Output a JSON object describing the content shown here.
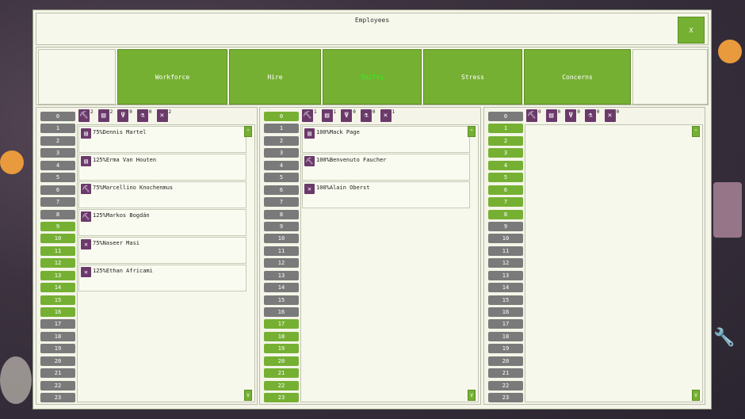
{
  "window": {
    "title": "Employees",
    "close_label": "X"
  },
  "tabs": [
    {
      "label": "Workforce",
      "active": false
    },
    {
      "label": "Hire",
      "active": false
    },
    {
      "label": "Shifts",
      "active": true
    },
    {
      "label": "Stress",
      "active": false
    },
    {
      "label": "Concerns",
      "active": false
    }
  ],
  "role_icons": [
    "pickaxe-icon",
    "scroll-icon",
    "cutlery-icon",
    "flask-icon",
    "crossed-tools-icon"
  ],
  "shifts": [
    {
      "role_counts": [
        "2",
        "2",
        "0",
        "0",
        "2"
      ],
      "active_hours": [
        9,
        10,
        11,
        12,
        13,
        14,
        15,
        16
      ],
      "workers": [
        {
          "text": "75%Dennis Martel",
          "icon": "scroll-icon"
        },
        {
          "text": "125%Erma Van Houten",
          "icon": "scroll-icon"
        },
        {
          "text": "75%Marcellino Knochenmus",
          "icon": "pickaxe-icon"
        },
        {
          "text": "125%Markos Bogdán",
          "icon": "pickaxe-icon"
        },
        {
          "text": "75%Naseer Masi",
          "icon": "crossed-tools-icon"
        },
        {
          "text": "125%Ethan Africami",
          "icon": "crossed-tools-icon"
        }
      ]
    },
    {
      "role_counts": [
        "1",
        "1",
        "0",
        "0",
        "1"
      ],
      "active_hours": [
        0,
        17,
        18,
        19,
        20,
        21,
        22,
        23
      ],
      "workers": [
        {
          "text": "100%Mack Page",
          "icon": "scroll-icon"
        },
        {
          "text": "100%Benvenuto Faucher",
          "icon": "pickaxe-icon"
        },
        {
          "text": "100%Alain Oberst",
          "icon": "crossed-tools-icon"
        }
      ]
    },
    {
      "role_counts": [
        "0",
        "0",
        "0",
        "0",
        "0"
      ],
      "active_hours": [
        1,
        2,
        3,
        4,
        5,
        6,
        7,
        8
      ],
      "workers": []
    }
  ],
  "hour_labels": [
    "0",
    "1",
    "2",
    "3",
    "4",
    "5",
    "6",
    "7",
    "8",
    "9",
    "10",
    "11",
    "12",
    "13",
    "14",
    "15",
    "16",
    "17",
    "18",
    "19",
    "20",
    "21",
    "22",
    "23"
  ],
  "scroll": {
    "up_label": "^",
    "down_label": "V"
  },
  "colors": {
    "accent_green": "#76b033",
    "inactive_gray": "#7a7a7a",
    "role_purple": "#6b3a6b",
    "active_tab_text": "#1aff1a"
  }
}
